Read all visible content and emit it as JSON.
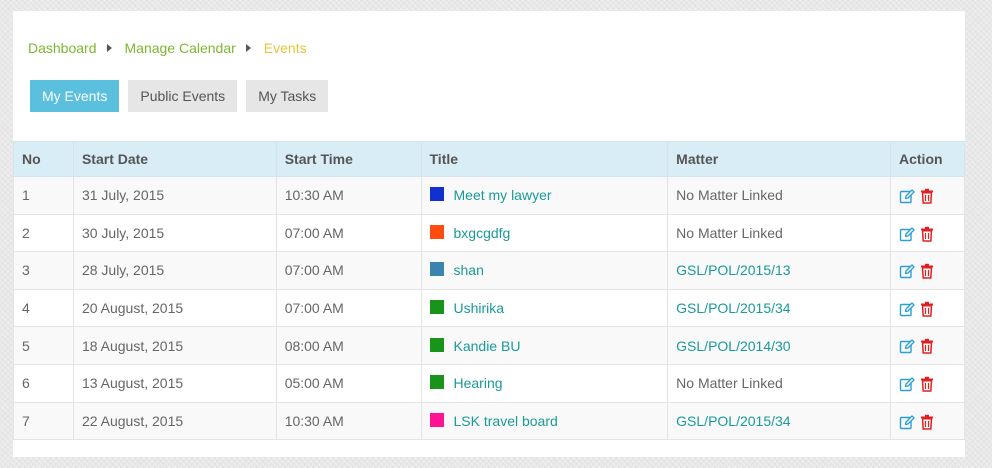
{
  "breadcrumb": {
    "items": [
      "Dashboard",
      "Manage Calendar"
    ],
    "current": "Events"
  },
  "tabs": [
    {
      "label": "My Events",
      "active": true
    },
    {
      "label": "Public Events",
      "active": false
    },
    {
      "label": "My Tasks",
      "active": false
    }
  ],
  "table": {
    "headers": [
      "No",
      "Start Date",
      "Start Time",
      "Title",
      "Matter",
      "Action"
    ],
    "rows": [
      {
        "no": "1",
        "date": "31 July, 2015",
        "time": "10:30 AM",
        "title": "Meet my lawyer",
        "color": "#1030d0",
        "matter": "No Matter Linked",
        "matter_linked": false
      },
      {
        "no": "2",
        "date": "30 July, 2015",
        "time": "07:00 AM",
        "title": "bxgcgdfg",
        "color": "#ff4d12",
        "matter": "No Matter Linked",
        "matter_linked": false
      },
      {
        "no": "3",
        "date": "28 July, 2015",
        "time": "07:00 AM",
        "title": "shan",
        "color": "#3a84ad",
        "matter": "GSL/POL/2015/13",
        "matter_linked": true
      },
      {
        "no": "4",
        "date": "20 August, 2015",
        "time": "07:00 AM",
        "title": "Ushirika",
        "color": "#18941a",
        "matter": "GSL/POL/2015/34",
        "matter_linked": true
      },
      {
        "no": "5",
        "date": "18 August, 2015",
        "time": "08:00 AM",
        "title": "Kandie BU",
        "color": "#18941a",
        "matter": "GSL/POL/2014/30",
        "matter_linked": true
      },
      {
        "no": "6",
        "date": "13 August, 2015",
        "time": "05:00 AM",
        "title": "Hearing",
        "color": "#18941a",
        "matter": "No Matter Linked",
        "matter_linked": false
      },
      {
        "no": "7",
        "date": "22 August, 2015",
        "time": "10:30 AM",
        "title": "LSK travel board",
        "color": "#ff1493",
        "matter": "GSL/POL/2015/34",
        "matter_linked": true
      }
    ]
  },
  "icons": {
    "edit": "edit-icon",
    "delete": "trash-icon"
  },
  "colors": {
    "accent": "#5bc0de",
    "link": "#1a9a9a",
    "breadcrumb_link": "#7cb82f",
    "breadcrumb_current": "#e8c53a",
    "delete": "#e02020",
    "edit": "#2a9fd6"
  }
}
